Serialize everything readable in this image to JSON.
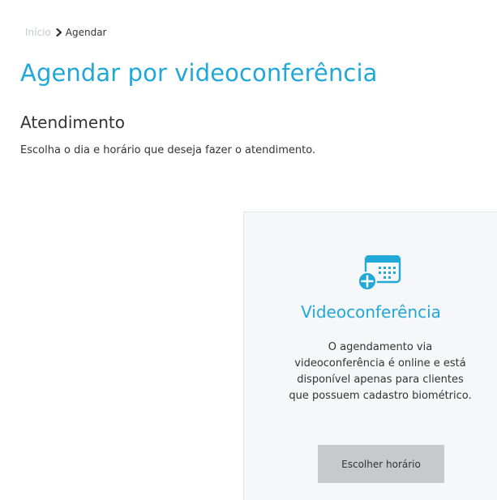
{
  "breadcrumb": {
    "home": "Início",
    "current": "Agendar"
  },
  "page": {
    "title": "Agendar por videoconferência"
  },
  "section": {
    "title": "Atendimento",
    "description": "Escolha o dia e horário que deseja fazer o atendimento."
  },
  "card": {
    "icon": "calendar-plus-icon",
    "title": "Videoconferência",
    "description_lines": [
      "O agendamento via",
      "videoconferência é online e está",
      "disponível apenas para clientes",
      "que possuem cadastro biométrico."
    ],
    "button_label": "Escolher horário"
  },
  "colors": {
    "accent": "#20a8d8",
    "button_bg": "#c8c9cb",
    "card_bg": "#f6f7f9",
    "muted": "#c3c8cc"
  }
}
